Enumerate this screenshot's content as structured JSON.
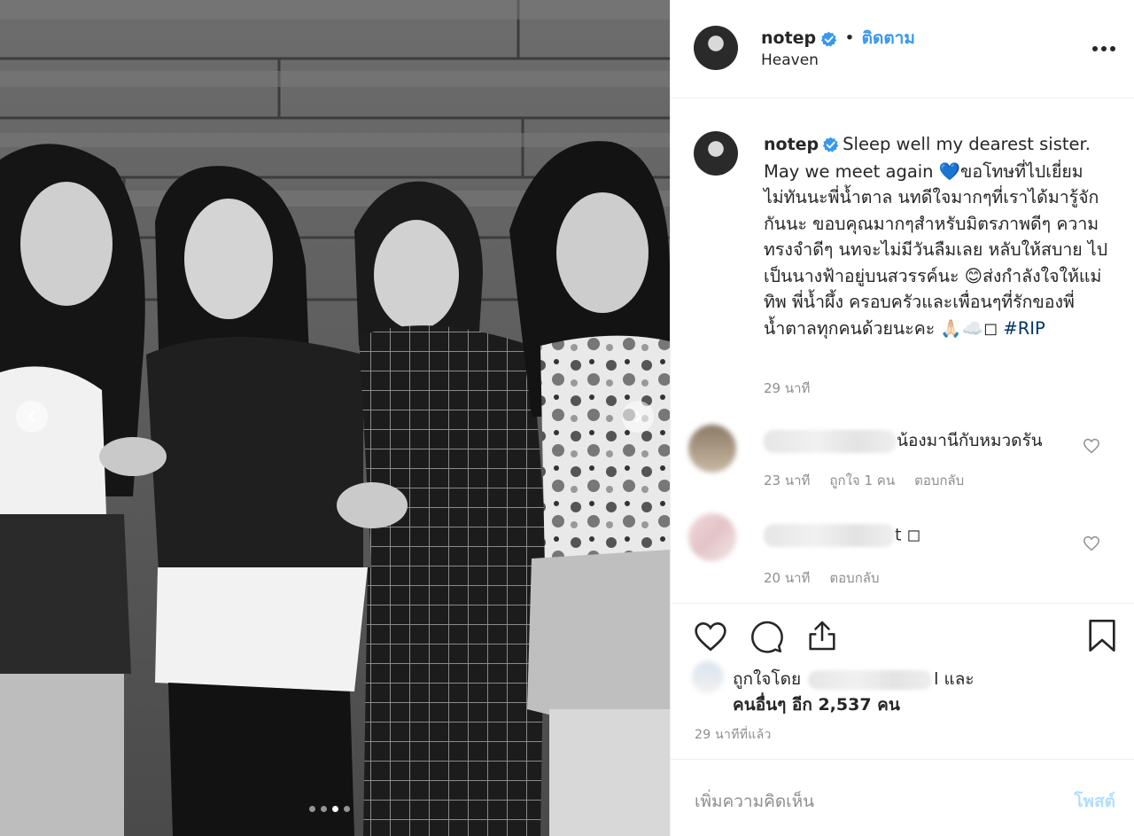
{
  "post": {
    "username": "notep",
    "follow_label": "ติดตาม",
    "separator": "•",
    "location": "Heaven",
    "more_label": "•••"
  },
  "photo": {
    "carousel_count": 4,
    "active_index": 2
  },
  "caption": {
    "username": "notep",
    "text": "Sleep well my dearest sister. May we meet again 💙ขอโทษที่ไปเยี่ยมไม่ทันนะพี่น้ำตาล นทดีใจมากๆที่เราได้มารู้จักกันนะ ขอบคุณมากๆสำหรับมิตรภาพดีๆ ความทรงจำดีๆ นทจะไม่มีวันลืมเลย หลับให้สบาย ไปเป็นนางฟ้าอยู่บนสวรรค์นะ 😊ส่งกำลังใจให้แม่ ทิพ พี่น้ำผึ้ง ครอบครัวและเพื่อนๆที่รักของพี่น้ำตาลทุกคนด้วยนะคะ 🙏🏻☁️",
    "box": "◻",
    "hashtag": "#RIP",
    "time": "29 นาที"
  },
  "comments": [
    {
      "text": "น้องมานีกับหมวดรัน",
      "time": "23 นาที",
      "likes": "ถูกใจ 1 คน",
      "reply": "ตอบกลับ"
    },
    {
      "text": "t ◻",
      "time": "20 นาที",
      "reply": "ตอบกลับ"
    }
  ],
  "likes": {
    "prefix": "ถูกใจโดย",
    "suffix": "l และ",
    "others": "คนอื่นๆ อีก 2,537 คน"
  },
  "posted_time": "29 นาทีที่แล้ว",
  "add_comment": {
    "placeholder": "เพิ่มความคิดเห็น",
    "post_label": "โพสต์"
  },
  "colors": {
    "link_blue": "#3897f0",
    "verified_blue": "#3897f0",
    "hashtag": "#003569",
    "muted": "#8e8e8e",
    "post_disabled": "#b2dffc"
  }
}
